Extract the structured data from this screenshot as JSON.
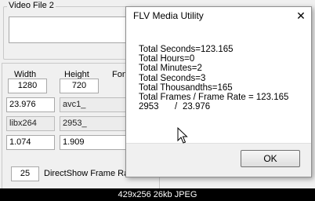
{
  "background_window": {
    "video_file_group_label": "Video File 2",
    "labels": {
      "width": "Width",
      "height": "Height",
      "format_partial": "Fon",
      "directshow": "DirectShow Frame Rate"
    },
    "fields": {
      "width": "1280",
      "height": "720",
      "frame_rate": "23.976",
      "codec": "avc1_",
      "encoder": "libx264",
      "frames": "2953_",
      "aspect_ratio": "1.074",
      "value_b": "1.909",
      "directshow_rate": "25"
    }
  },
  "dialog": {
    "title": "FLV Media Utility",
    "close_glyph": "✕",
    "lines": [
      "Total Seconds=123.165",
      "Total Hours=0",
      "Total Minutes=2",
      "Total Seconds=3",
      "Total Thousandths=165",
      "Total Frames / Frame  Rate = 123.165"
    ],
    "frames_value": "2953",
    "frames_separator": "/",
    "frame_rate_value": "23.976",
    "ok_label": "OK"
  },
  "image_caption": "429x256 26kb JPEG"
}
